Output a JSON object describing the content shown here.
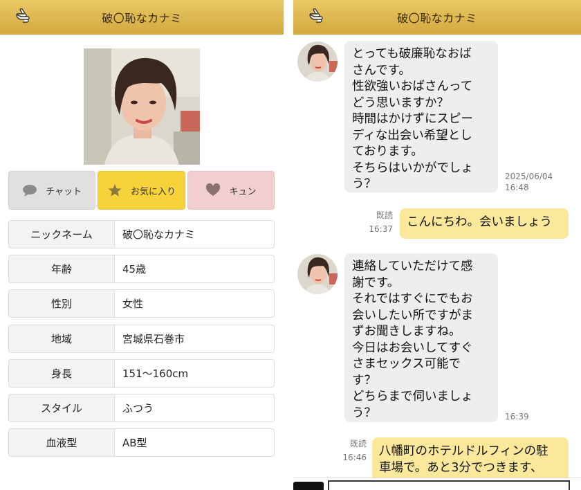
{
  "colors": {
    "header": "#dcb64f",
    "fav_button": "#f7d23a",
    "kyun_button": "#f2cfcf",
    "chat_button": "#e0e0e0",
    "incoming_bubble": "#eeeeee",
    "outgoing_bubble": "#fbe89a"
  },
  "profile": {
    "header": {
      "title": "破〇恥なカナミ",
      "back_icon": "pointing-hand-icon"
    },
    "actions": [
      {
        "label": "チャット",
        "icon": "speech-bubble-icon"
      },
      {
        "label": "お気に入り",
        "icon": "star-icon"
      },
      {
        "label": "キュン",
        "icon": "heart-icon"
      }
    ],
    "fields": [
      {
        "label": "ニックネーム",
        "value": "破〇恥なカナミ"
      },
      {
        "label": "年齢",
        "value": "45歳"
      },
      {
        "label": "性別",
        "value": "女性"
      },
      {
        "label": "地域",
        "value": "宮城県石巻市"
      },
      {
        "label": "身長",
        "value": "151〜160cm"
      },
      {
        "label": "スタイル",
        "value": "ふつう"
      },
      {
        "label": "血液型",
        "value": "AB型"
      }
    ]
  },
  "chat": {
    "header": {
      "title": "破〇恥なカナミ",
      "back_icon": "pointing-hand-icon"
    },
    "messages": [
      {
        "from": "other",
        "text": "とっても破廉恥なおば\nさんです。\n性欲強いおばさんって\nどう思いますか？\n時間はかけずにスピー\nディな出会い希望とし\nております。\nそちらはいかがでしょ\nう？",
        "time": "2025/06/04\n16:48"
      },
      {
        "from": "me",
        "read": "既読",
        "time": "16:37",
        "text": "こんにちわ。会いましょう"
      },
      {
        "from": "other",
        "text": "連絡していただけて感\n謝です。\nそれではすぐにでもお\n会いしたい所ですがま\nずお聞きしますね。\n今日はお会いしてすぐ\nさまセックス可能で\nす？\nどちらまで伺いましょ\nう？",
        "time": "16:39"
      },
      {
        "from": "me",
        "read": "既読",
        "time": "16:46",
        "text": "八幡町のホテルドルフィンの駐\n車場で。あと3分でつきます、"
      }
    ]
  }
}
